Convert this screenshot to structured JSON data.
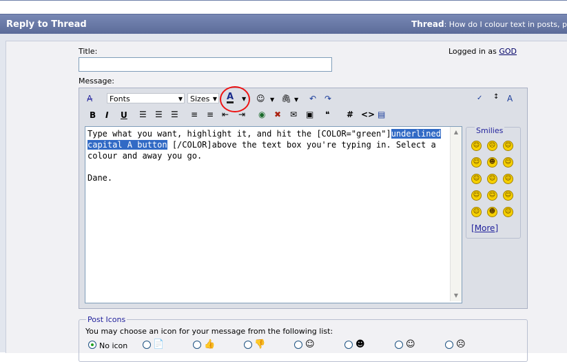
{
  "header": {
    "title": "Reply to Thread",
    "thread_label": "Thread",
    "thread_title": ": How do I colour text in posts, p"
  },
  "form": {
    "title_label": "Title:",
    "title_value": "",
    "logged_in_prefix": "Logged in as",
    "logged_in_user": "GOD",
    "message_label": "Message:"
  },
  "toolbar": {
    "font_select": "Fonts",
    "size_select": "Sizes",
    "font_color_glyph": "A",
    "bold": "B",
    "italic": "I",
    "underline": "U",
    "code_hash": "#",
    "html_tag": "<>"
  },
  "message": {
    "line1_before": "Type what you want, highlight it, and hit the [COLOR=\"green\"]",
    "line1_highlight": "underlined",
    "line2_highlight": "capital A button",
    "line2_after": " [/COLOR]above the text box you're typing in. Select a colour and away you go.",
    "line3": "",
    "signature": "Dane."
  },
  "smilies": {
    "heading": "Smilies",
    "more_label": "More",
    "faces": [
      "☺",
      "☹",
      "☺",
      "☺",
      "☻",
      "☺",
      "☺",
      "☺",
      "☺",
      "☺",
      "☺",
      "☺",
      "☺",
      "☻",
      "☺"
    ]
  },
  "post_icons": {
    "heading": "Post Icons",
    "description": "You may choose an icon for your message from the following list:",
    "no_icon_label": "No icon"
  },
  "colors": {
    "header_bg": "#6677a8",
    "highlight": "#316ac5",
    "annotation": "#ee1111"
  }
}
